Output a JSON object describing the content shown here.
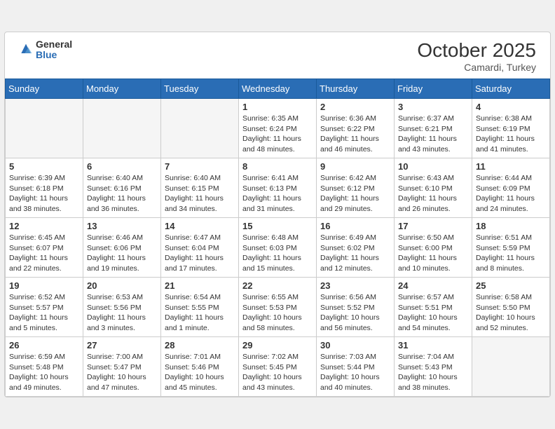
{
  "header": {
    "logo_general": "General",
    "logo_blue": "Blue",
    "month_title": "October 2025",
    "location": "Camardi, Turkey"
  },
  "days_of_week": [
    "Sunday",
    "Monday",
    "Tuesday",
    "Wednesday",
    "Thursday",
    "Friday",
    "Saturday"
  ],
  "weeks": [
    [
      {
        "day": "",
        "info": ""
      },
      {
        "day": "",
        "info": ""
      },
      {
        "day": "",
        "info": ""
      },
      {
        "day": "1",
        "info": "Sunrise: 6:35 AM\nSunset: 6:24 PM\nDaylight: 11 hours\nand 48 minutes."
      },
      {
        "day": "2",
        "info": "Sunrise: 6:36 AM\nSunset: 6:22 PM\nDaylight: 11 hours\nand 46 minutes."
      },
      {
        "day": "3",
        "info": "Sunrise: 6:37 AM\nSunset: 6:21 PM\nDaylight: 11 hours\nand 43 minutes."
      },
      {
        "day": "4",
        "info": "Sunrise: 6:38 AM\nSunset: 6:19 PM\nDaylight: 11 hours\nand 41 minutes."
      }
    ],
    [
      {
        "day": "5",
        "info": "Sunrise: 6:39 AM\nSunset: 6:18 PM\nDaylight: 11 hours\nand 38 minutes."
      },
      {
        "day": "6",
        "info": "Sunrise: 6:40 AM\nSunset: 6:16 PM\nDaylight: 11 hours\nand 36 minutes."
      },
      {
        "day": "7",
        "info": "Sunrise: 6:40 AM\nSunset: 6:15 PM\nDaylight: 11 hours\nand 34 minutes."
      },
      {
        "day": "8",
        "info": "Sunrise: 6:41 AM\nSunset: 6:13 PM\nDaylight: 11 hours\nand 31 minutes."
      },
      {
        "day": "9",
        "info": "Sunrise: 6:42 AM\nSunset: 6:12 PM\nDaylight: 11 hours\nand 29 minutes."
      },
      {
        "day": "10",
        "info": "Sunrise: 6:43 AM\nSunset: 6:10 PM\nDaylight: 11 hours\nand 26 minutes."
      },
      {
        "day": "11",
        "info": "Sunrise: 6:44 AM\nSunset: 6:09 PM\nDaylight: 11 hours\nand 24 minutes."
      }
    ],
    [
      {
        "day": "12",
        "info": "Sunrise: 6:45 AM\nSunset: 6:07 PM\nDaylight: 11 hours\nand 22 minutes."
      },
      {
        "day": "13",
        "info": "Sunrise: 6:46 AM\nSunset: 6:06 PM\nDaylight: 11 hours\nand 19 minutes."
      },
      {
        "day": "14",
        "info": "Sunrise: 6:47 AM\nSunset: 6:04 PM\nDaylight: 11 hours\nand 17 minutes."
      },
      {
        "day": "15",
        "info": "Sunrise: 6:48 AM\nSunset: 6:03 PM\nDaylight: 11 hours\nand 15 minutes."
      },
      {
        "day": "16",
        "info": "Sunrise: 6:49 AM\nSunset: 6:02 PM\nDaylight: 11 hours\nand 12 minutes."
      },
      {
        "day": "17",
        "info": "Sunrise: 6:50 AM\nSunset: 6:00 PM\nDaylight: 11 hours\nand 10 minutes."
      },
      {
        "day": "18",
        "info": "Sunrise: 6:51 AM\nSunset: 5:59 PM\nDaylight: 11 hours\nand 8 minutes."
      }
    ],
    [
      {
        "day": "19",
        "info": "Sunrise: 6:52 AM\nSunset: 5:57 PM\nDaylight: 11 hours\nand 5 minutes."
      },
      {
        "day": "20",
        "info": "Sunrise: 6:53 AM\nSunset: 5:56 PM\nDaylight: 11 hours\nand 3 minutes."
      },
      {
        "day": "21",
        "info": "Sunrise: 6:54 AM\nSunset: 5:55 PM\nDaylight: 11 hours\nand 1 minute."
      },
      {
        "day": "22",
        "info": "Sunrise: 6:55 AM\nSunset: 5:53 PM\nDaylight: 10 hours\nand 58 minutes."
      },
      {
        "day": "23",
        "info": "Sunrise: 6:56 AM\nSunset: 5:52 PM\nDaylight: 10 hours\nand 56 minutes."
      },
      {
        "day": "24",
        "info": "Sunrise: 6:57 AM\nSunset: 5:51 PM\nDaylight: 10 hours\nand 54 minutes."
      },
      {
        "day": "25",
        "info": "Sunrise: 6:58 AM\nSunset: 5:50 PM\nDaylight: 10 hours\nand 52 minutes."
      }
    ],
    [
      {
        "day": "26",
        "info": "Sunrise: 6:59 AM\nSunset: 5:48 PM\nDaylight: 10 hours\nand 49 minutes."
      },
      {
        "day": "27",
        "info": "Sunrise: 7:00 AM\nSunset: 5:47 PM\nDaylight: 10 hours\nand 47 minutes."
      },
      {
        "day": "28",
        "info": "Sunrise: 7:01 AM\nSunset: 5:46 PM\nDaylight: 10 hours\nand 45 minutes."
      },
      {
        "day": "29",
        "info": "Sunrise: 7:02 AM\nSunset: 5:45 PM\nDaylight: 10 hours\nand 43 minutes."
      },
      {
        "day": "30",
        "info": "Sunrise: 7:03 AM\nSunset: 5:44 PM\nDaylight: 10 hours\nand 40 minutes."
      },
      {
        "day": "31",
        "info": "Sunrise: 7:04 AM\nSunset: 5:43 PM\nDaylight: 10 hours\nand 38 minutes."
      },
      {
        "day": "",
        "info": ""
      }
    ]
  ]
}
